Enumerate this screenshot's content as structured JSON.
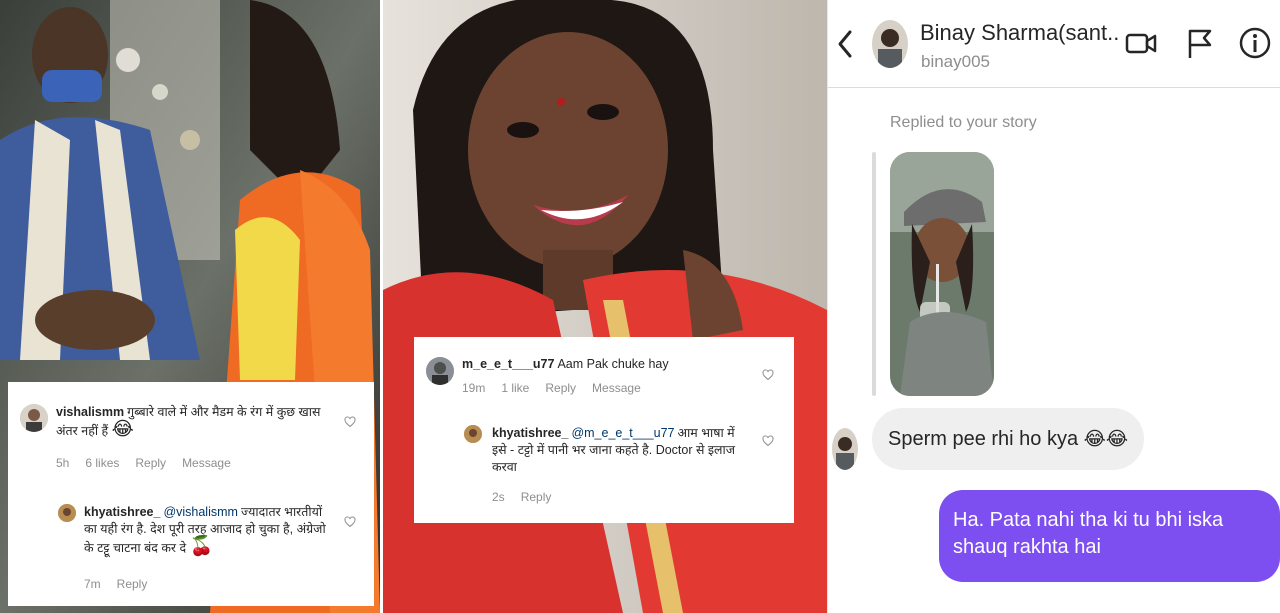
{
  "colors": {
    "sent_bubble": "#7d4ef0",
    "received_bubble": "#efefef",
    "meta_text": "#8e8e8e",
    "mention": "#00376b"
  },
  "panel_left": {
    "comment_card": {
      "comment": {
        "username": "vishalismm",
        "text": "गुब्बारे वाले में और मैडम के रंग में कुछ खास अंतर नहीं हैं",
        "emoji": "😂",
        "time": "5h",
        "likes": "6 likes",
        "reply": "Reply",
        "message": "Message"
      },
      "reply": {
        "username": "khyatishree_",
        "mention": "@vishalismm",
        "text": "ज्यादातर भारतीयों का यही रंग है. देश पूरी तरह आजाद हो चुका है, अंग्रेजो के टट्टू चाटना बंद कर दे",
        "emoji": "🍒",
        "time": "7m",
        "reply": "Reply"
      }
    }
  },
  "panel_middle": {
    "comment_card": {
      "comment": {
        "username": "m_e_e_t___u77",
        "text": "Aam Pak chuke hay",
        "time": "19m",
        "likes": "1 like",
        "reply": "Reply",
        "message": "Message"
      },
      "reply": {
        "username": "khyatishree_",
        "mention": "@m_e_e_t___u77",
        "text": "आम भाषा में इसे - टट्टो में पानी भर जाना कहते है. Doctor से इलाज करवा",
        "time": "2s",
        "reply": "Reply"
      }
    }
  },
  "dm": {
    "header": {
      "name": "Binay Sharma(sant...",
      "handle": "binay005",
      "icons": [
        "chevron-left-icon",
        "video-call-icon",
        "flag-icon",
        "info-icon"
      ]
    },
    "story_label": "Replied to your story",
    "messages": {
      "received": {
        "text": "Sperm pee rhi ho kya",
        "emoji": "😂😂"
      },
      "sent": {
        "text": "Ha. Pata nahi tha ki tu bhi iska shauq rakhta hai"
      }
    }
  }
}
